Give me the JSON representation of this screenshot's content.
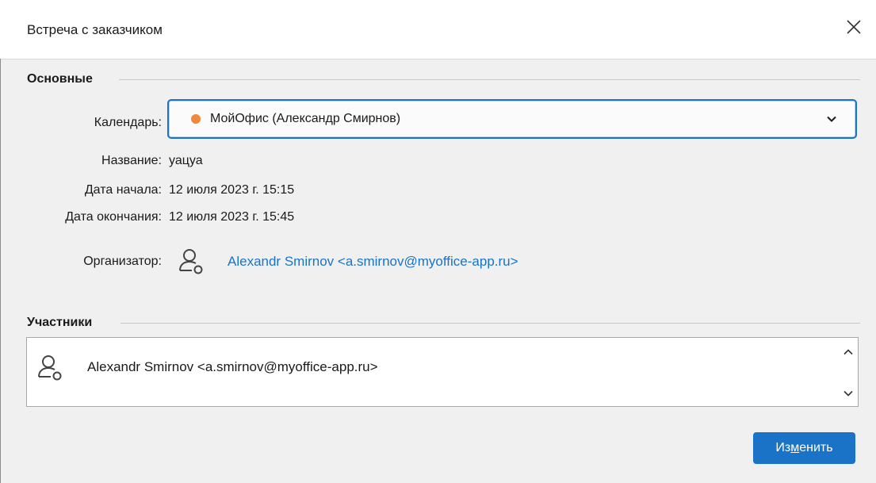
{
  "window": {
    "title": "Встреча с заказчиком"
  },
  "sections": {
    "main": "Основные",
    "participants": "Участники"
  },
  "fields": {
    "calendar_label": "Календарь:",
    "calendar_value": "МойОфис (Александр Смирнов)",
    "calendar_color": "#f0883e",
    "name_label": "Название:",
    "name_value": "уацуа",
    "start_label": "Дата начала:",
    "start_value": "12 июля 2023 г. 15:15",
    "end_label": "Дата окончания:",
    "end_value": "12 июля 2023 г. 15:45",
    "organizer_label": "Организатор:",
    "organizer_value": "Alexandr Smirnov <a.smirnov@myoffice-app.ru>"
  },
  "participants": [
    {
      "name": "Alexandr Smirnov <a.smirnov@myoffice-app.ru>",
      "icon": "user-icon"
    }
  ],
  "buttons": {
    "edit_prefix": "Из",
    "edit_mnemonic": "м",
    "edit_suffix": "енить"
  },
  "colors": {
    "accent": "#1a73c7",
    "calendar_dot": "#f0883e"
  }
}
